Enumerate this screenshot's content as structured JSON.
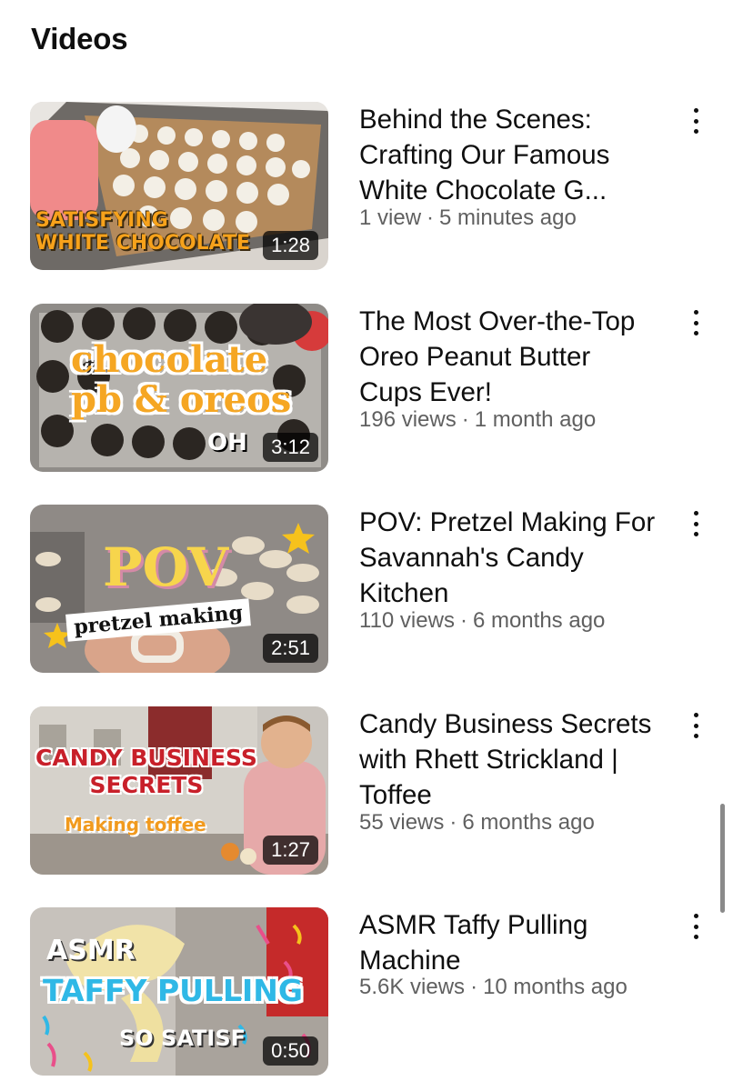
{
  "section": {
    "title": "Videos"
  },
  "videos": [
    {
      "title": "Behind the Scenes: Crafting Our Famous White Chocolate G...",
      "views": "1 view",
      "age": "5 minutes ago",
      "duration": "1:28",
      "thumb_text": [
        "SATISFYING",
        "WHITE CHOCOLATE"
      ]
    },
    {
      "title": "The Most Over-the-Top Oreo Peanut Butter Cups Ever!",
      "views": "196 views",
      "age": "1 month ago",
      "duration": "3:12",
      "thumb_text": [
        "chocolate",
        "pb & oreos",
        "OH"
      ]
    },
    {
      "title": "POV: Pretzel Making For Savannah's Candy Kitchen",
      "views": "110 views",
      "age": "6 months ago",
      "duration": "2:51",
      "thumb_text": [
        "POV",
        "pretzel making"
      ]
    },
    {
      "title": "Candy Business Secrets with Rhett Strickland | Toffee",
      "views": "55 views",
      "age": "6 months ago",
      "duration": "1:27",
      "thumb_text": [
        "CANDY BUSINESS",
        "SECRETS",
        "Making toffee"
      ]
    },
    {
      "title": "ASMR Taffy Pulling Machine",
      "views": "5.6K views",
      "age": "10 months ago",
      "duration": "0:50",
      "thumb_text": [
        "ASMR",
        "TAFFY PULLING",
        "SO SATISF"
      ]
    }
  ],
  "meta_separator": "·",
  "icons": {
    "more": "vertical-ellipsis-icon"
  },
  "colors": {
    "text": "#0f0f0f",
    "meta": "#606060",
    "duration_bg": "#000000"
  }
}
